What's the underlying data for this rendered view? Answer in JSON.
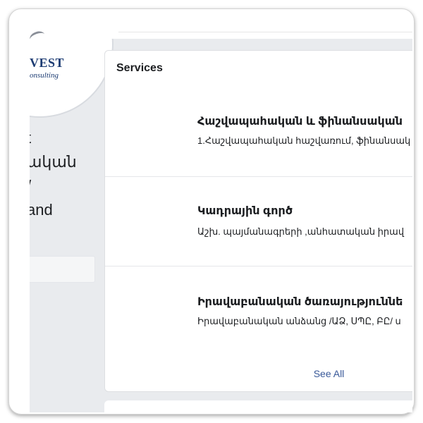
{
  "logo": {
    "brand": "VEST",
    "tagline": "onsulting"
  },
  "page": {
    "name_lines": [
      "t",
      "ական",
      "/",
      "and"
    ]
  },
  "services": {
    "title": "Services",
    "items": [
      {
        "title": "Հաշվապահական և ֆինանսական",
        "description": "1.Հաշվապահական հաշվառում, ֆինանսակ"
      },
      {
        "title": "Կադրային գործ",
        "description": "Աշխ. պայմանագրերի ,անհատական իրավ"
      },
      {
        "title": "Իրավաբանական ծառայություննե",
        "description": "Իրավաբանական անձանց /ԱՁ, ՍՊԸ, ԲԸ/ ս"
      }
    ],
    "see_all": "See All"
  },
  "colors": {
    "background": "#e9ebee",
    "card": "#ffffff",
    "link": "#385898",
    "logo": "#1d3c73"
  }
}
